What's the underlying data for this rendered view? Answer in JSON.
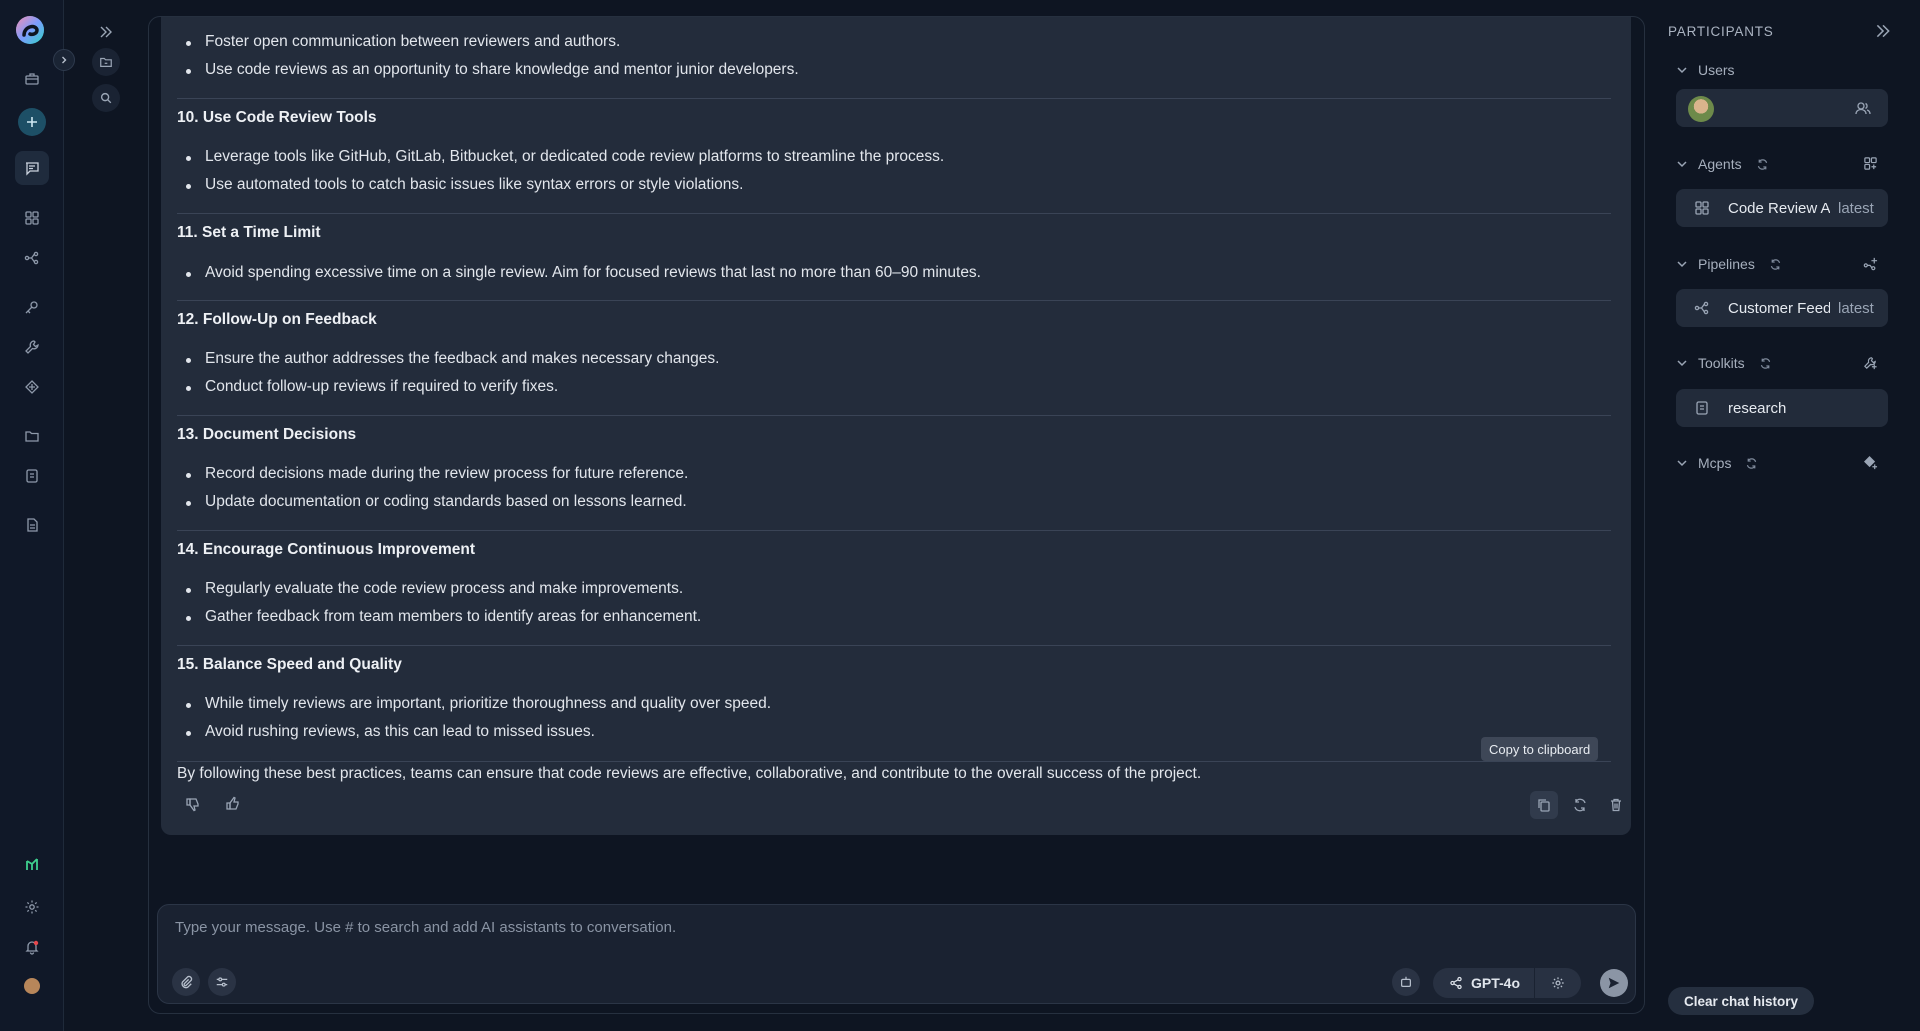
{
  "message": {
    "lines": [
      {
        "kind": "bullet",
        "text": "Foster open communication between reviewers and authors."
      },
      {
        "kind": "bullet",
        "text": "Use code reviews as an opportunity to share knowledge and mentor junior developers."
      },
      {
        "kind": "heading",
        "text": "10. Use Code Review Tools"
      },
      {
        "kind": "bullet",
        "text": "Leverage tools like GitHub, GitLab, Bitbucket, or dedicated code review platforms to streamline the process."
      },
      {
        "kind": "bullet",
        "text": "Use automated tools to catch basic issues like syntax errors or style violations."
      },
      {
        "kind": "heading",
        "text": "11. Set a Time Limit"
      },
      {
        "kind": "bullet",
        "text": "Avoid spending excessive time on a single review. Aim for focused reviews that last no more than 60–90 minutes."
      },
      {
        "kind": "heading",
        "text": "12. Follow-Up on Feedback"
      },
      {
        "kind": "bullet",
        "text": "Ensure the author addresses the feedback and makes necessary changes."
      },
      {
        "kind": "bullet",
        "text": "Conduct follow-up reviews if required to verify fixes."
      },
      {
        "kind": "heading",
        "text": "13. Document Decisions"
      },
      {
        "kind": "bullet",
        "text": "Record decisions made during the review process for future reference."
      },
      {
        "kind": "bullet",
        "text": "Update documentation or coding standards based on lessons learned."
      },
      {
        "kind": "heading",
        "text": "14. Encourage Continuous Improvement"
      },
      {
        "kind": "bullet",
        "text": "Regularly evaluate the code review process and make improvements."
      },
      {
        "kind": "bullet",
        "text": "Gather feedback from team members to identify areas for enhancement."
      },
      {
        "kind": "heading",
        "text": "15. Balance Speed and Quality"
      },
      {
        "kind": "bullet",
        "text": "While timely reviews are important, prioritize thoroughness and quality over speed."
      },
      {
        "kind": "bullet",
        "text": "Avoid rushing reviews, as this can lead to missed issues."
      }
    ],
    "conclusion": "By following these best practices, teams can ensure that code reviews are effective, collaborative, and contribute to the overall success of the project.",
    "tooltip": "Copy to clipboard"
  },
  "composer": {
    "placeholder": "Type your message. Use # to search and add AI assistants to conversation.",
    "model": "GPT-4o"
  },
  "participants": {
    "title": "PARTICIPANTS",
    "users_label": "Users",
    "agents_label": "Agents",
    "agent_name": "Code Review Assistant",
    "agent_version": "latest",
    "pipelines_label": "Pipelines",
    "pipeline_name": "Customer Feedback",
    "pipeline_version": "latest",
    "toolkits_label": "Toolkits",
    "toolkit_name": "research",
    "mcps_label": "Mcps",
    "clear_label": "Clear chat history"
  },
  "icons": {
    "rail": [
      "app-logo",
      "briefcase-icon",
      "plus-icon",
      "chat-icon",
      "grid-icon",
      "pipeline-icon",
      "key-icon",
      "wrench-icon",
      "diamond-icon",
      "folder-icon",
      "database-icon",
      "document-icon",
      "activity-icon",
      "gear-icon",
      "bell-icon",
      "avatar"
    ]
  },
  "colors": {
    "accent": "#1d4f66",
    "background": "#0e1522",
    "card": "#232c3b",
    "notification": "#e5484d",
    "activity": "#3ecf8e"
  }
}
